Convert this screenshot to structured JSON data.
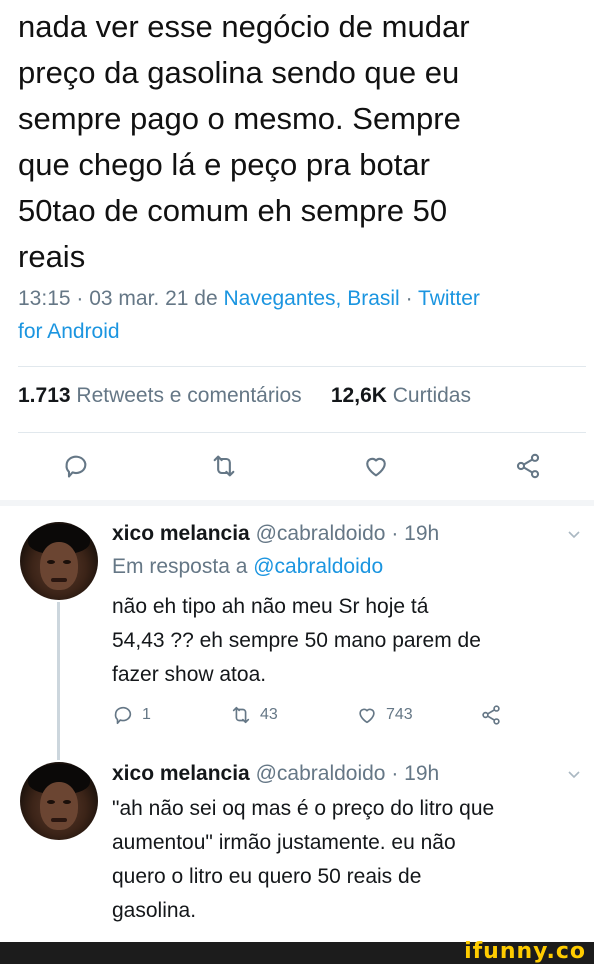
{
  "tweet": {
    "text_lines": [
      "nada ver esse negócio de mudar",
      "preço da gasolina sendo que eu",
      "sempre pago o mesmo. Sempre",
      "que chego lá e peço pra botar",
      "50tao de comum eh sempre 50",
      "reais"
    ],
    "time": "13:15 · 03 mar. 21 de ",
    "location": "Navegantes, Brasil",
    "separator": " · ",
    "source_line1": "Twitter",
    "source_line2": "for Android",
    "retweets_count": "1.713",
    "retweets_label": "Retweets e comentários",
    "likes_count": "12,6K",
    "likes_label": "Curtidas"
  },
  "replies": [
    {
      "name": "xico melancia",
      "handle": "@cabraldoido",
      "time": "· 19h",
      "replying_prefix": "Em resposta a ",
      "replying_to": "@cabraldoido",
      "body_lines": [
        "não eh tipo ah não meu Sr hoje tá",
        "54,43 ?? eh sempre 50 mano parem de",
        "fazer show atoa."
      ],
      "reply_count": "1",
      "retweet_count": "43",
      "like_count": "743"
    },
    {
      "name": "xico melancia",
      "handle": "@cabraldoido",
      "time": "· 19h",
      "body_lines": [
        "\"ah não sei oq mas é o preço do litro que",
        "aumentou\" irmão justamente. eu não",
        "quero o litro eu quero 50 reais de",
        "gasolina."
      ]
    }
  ],
  "watermark": "ifunny.co",
  "colors": {
    "link": "#1b95e0",
    "muted": "#657786",
    "text": "#14171a",
    "divider": "#e1e8ed",
    "watermark": "#ffcc00"
  },
  "icons": [
    "comment-icon",
    "retweet-icon",
    "heart-icon",
    "share-icon",
    "chevron-down-icon"
  ]
}
